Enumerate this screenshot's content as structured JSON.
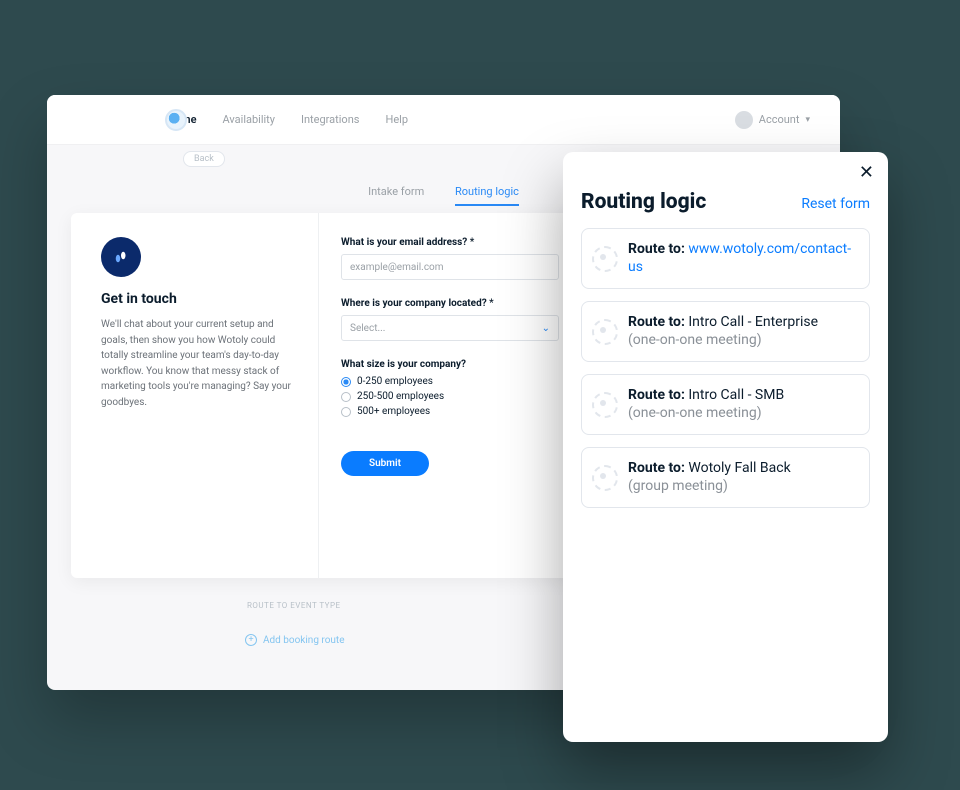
{
  "nav": {
    "home": "Home",
    "availability": "Availability",
    "integrations": "Integrations",
    "help": "Help",
    "account": "Account"
  },
  "back_button": "Back",
  "tabs": {
    "intake": "Intake form",
    "routing": "Routing logic"
  },
  "intake_card": {
    "title": "Get in touch",
    "body": "We'll chat about your current setup and goals, then show you how Wotoly could totally streamline your team's day-to-day workflow. You know that messy stack of marketing tools you're managing? Say your goodbyes."
  },
  "form": {
    "email_label": "What is your email address? *",
    "email_placeholder": "example@email.com",
    "location_label": "Where is your company located? *",
    "location_placeholder": "Select...",
    "size_label": "What size is your company?",
    "size_options": [
      "0-250 employees",
      "250-500 employees",
      "500+ employees"
    ],
    "size_selected_index": 0,
    "submit": "Submit"
  },
  "below": {
    "section_label": "ROUTE TO EVENT TYPE",
    "add_route": "Add booking route"
  },
  "panel": {
    "title": "Routing logic",
    "reset": "Reset form",
    "route_label": "Route to:",
    "routes": [
      {
        "dest": "www.wotoly.com/contact-us",
        "is_link": true,
        "sub": ""
      },
      {
        "dest": "Intro Call - Enterprise",
        "is_link": false,
        "sub": "(one-on-one meeting)"
      },
      {
        "dest": "Intro Call - SMB",
        "is_link": false,
        "sub": "(one-on-one meeting)"
      },
      {
        "dest": "Wotoly Fall Back",
        "is_link": false,
        "sub": "(group meeting)"
      }
    ]
  }
}
